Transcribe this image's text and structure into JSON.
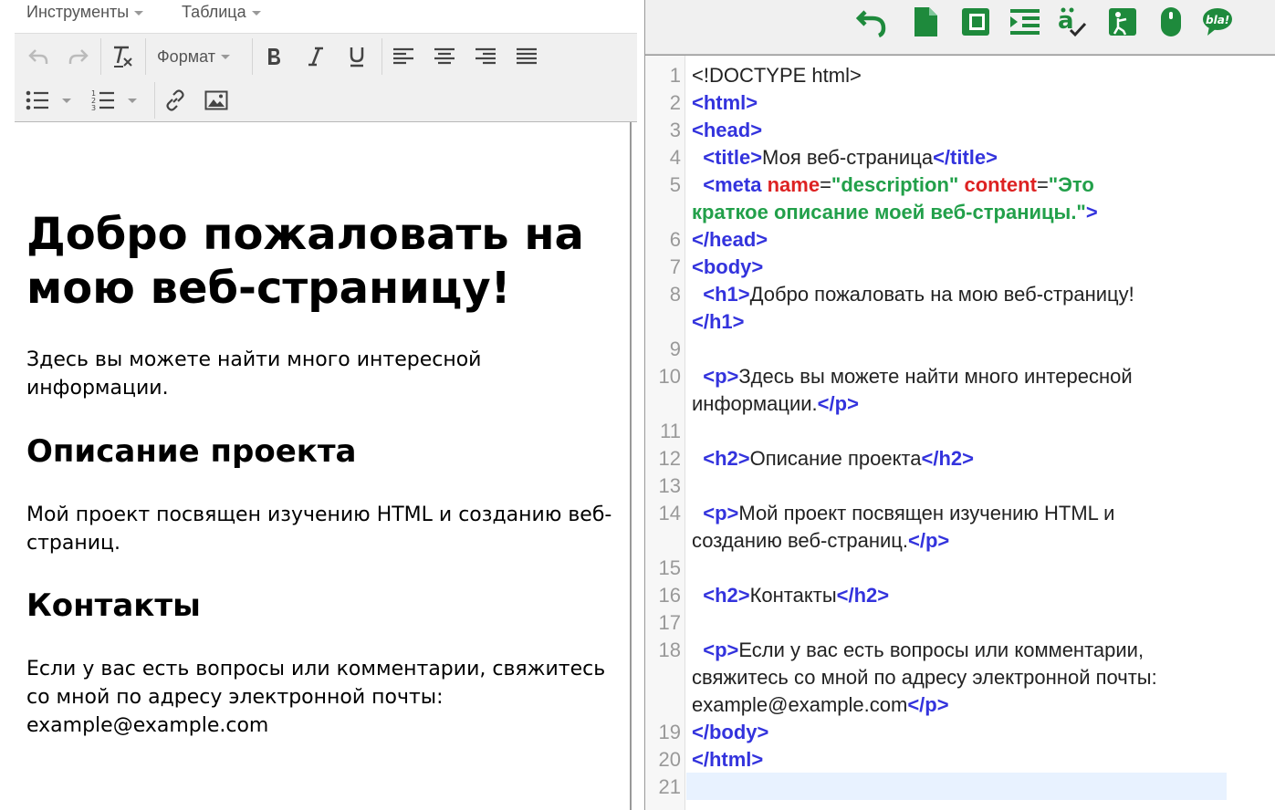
{
  "menubar": {
    "tools_label": "Инструменты",
    "table_label": "Таблица"
  },
  "toolbar": {
    "format_label": "Формат"
  },
  "preview": {
    "h1": "Добро пожаловать на моюｖеб-страницу!",
    "p1": "Здесь вы можете найти много интересной информации.",
    "h2_1": "Описание проекта",
    "p2": "Мой проект посвящен изучению HTML и созданию веб-страниц.",
    "h2_2": "Контакты",
    "p3": "Если у вас есть вопросы или комментарии, свяжитесь со мной по адресу электронной почты: example@example.com"
  },
  "code": {
    "line_numbers": [
      "1",
      "2",
      "3",
      "4",
      "5",
      "6",
      "7",
      "8",
      "9",
      "10",
      "11",
      "12",
      "13",
      "14",
      "15",
      "16",
      "17",
      "18",
      "19",
      "20",
      "21"
    ],
    "l1": "<!DOCTYPE html>",
    "l2": "<html>",
    "l3": "<head>",
    "l4_open": "<title>",
    "l4_text": "Моя веб-страница",
    "l4_close": "</title>",
    "l5_tag": "<meta",
    "l5_attr1": "name",
    "l5_eq": "=",
    "l5_val1": "\"description\"",
    "l5_attr2": "content",
    "l5_val2a": "\"Это",
    "l5_val2b": "краткое описание моей веб-страницы.\"",
    "l5_end": ">",
    "l6": "</head>",
    "l7": "<body>",
    "l8_open": "<h1>",
    "l8_text": "Добро пожаловать на мою веб-страницу!",
    "l8_close": "</h1>",
    "l10_open": "<p>",
    "l10_text_a": "Здесь вы можете найти много интересной",
    "l10_text_b": "информации.",
    "l10_close": "</p>",
    "l12_open": "<h2>",
    "l12_text": "Описание проекта",
    "l12_close": "</h2>",
    "l14_open": "<p>",
    "l14_text_a": "Мой проект посвящен изучению HTML и",
    "l14_text_b": "созданию веб-страниц.",
    "l14_close": "</p>",
    "l16_open": "<h2>",
    "l16_text": "Контакты",
    "l16_close": "</h2>",
    "l18_open": "<p>",
    "l18_text_a": "Если у вас есть вопросы или комментарии,",
    "l18_text_b": "свяжитесь со мной по адресу электронной почты:",
    "l18_text_c": "example@example.com",
    "l18_close": "</p>",
    "l19": "</body>",
    "l20": "</html>"
  },
  "colors": {
    "tag": "#3333dd",
    "attribute": "#dd2222",
    "string": "#22a04a",
    "icon_green": "#1e8a3c"
  },
  "right_toolbar_icons": [
    "undo-icon",
    "new-document-icon",
    "full-screen-icon",
    "indent-icon",
    "spell-check-icon",
    "validate-icon",
    "mouse-icon",
    "bla-comment-icon"
  ]
}
